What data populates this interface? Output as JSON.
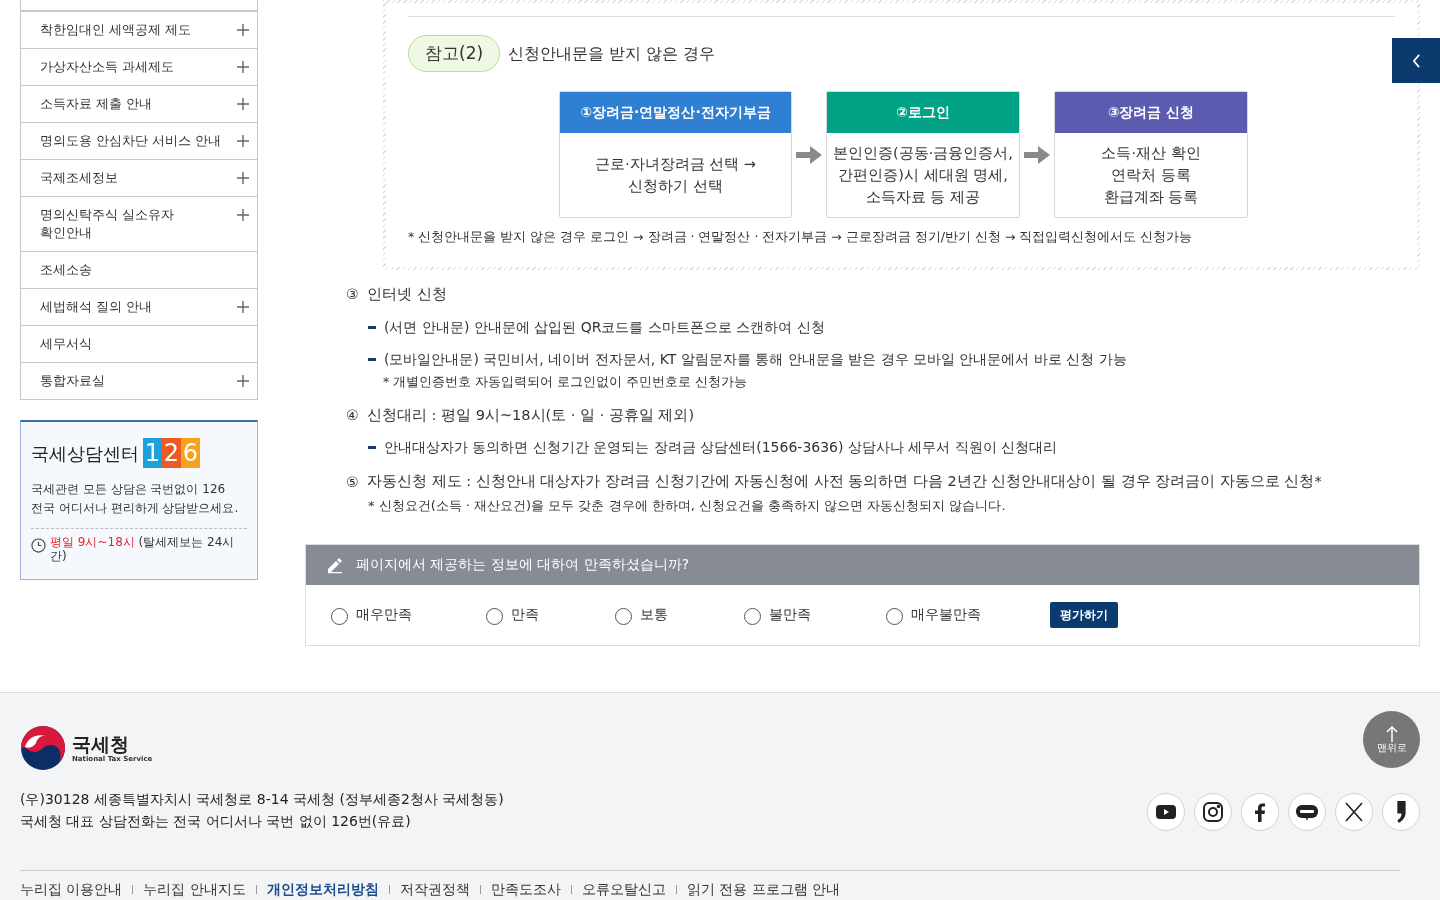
{
  "sidebar": {
    "items": [
      {
        "label": "착한임대인 세액공제 제도",
        "expandable": true
      },
      {
        "label": "가상자산소득 과세제도",
        "expandable": true
      },
      {
        "label": "소득자료 제출 안내",
        "expandable": true
      },
      {
        "label": "명의도용 안심차단 서비스 안내",
        "expandable": true
      },
      {
        "label": "국제조세정보",
        "expandable": true
      },
      {
        "label": "명의신탁주식 실소유자 확인안내",
        "expandable": true
      },
      {
        "label": "조세소송",
        "expandable": false
      },
      {
        "label": "세법해석 질의 안내",
        "expandable": true
      },
      {
        "label": "세무서식",
        "expandable": false
      },
      {
        "label": "통합자료실",
        "expandable": true
      }
    ]
  },
  "counsel": {
    "title": "국세상담센터",
    "digits": [
      "1",
      "2",
      "6"
    ],
    "description": [
      "국세관련 모든 상담은 국번없이 126",
      "전국 어디서나 편리하게 상담받으세요."
    ],
    "hours": "평일 9시~18시",
    "hours_note": "(탈세제보는 24시간)"
  },
  "reference": {
    "badge": "참고(2)",
    "title": "신청안내문을 받지 않은 경우",
    "steps": [
      {
        "title": "①장려금·연말정산·전자기부금",
        "color": "#2f7fd2",
        "lines": [
          "근로·자녀장려금 선택 →",
          "신청하기 선택"
        ]
      },
      {
        "title": "②로그인",
        "color": "#00a386",
        "lines": [
          "본인인증(공동·금융인증서,",
          "간편인증)시 세대원 명세,",
          "소득자료 등 제공"
        ]
      },
      {
        "title": "③장려금 신청",
        "color": "#5b5bb0",
        "lines": [
          "소득·재산 확인",
          "연락처 등록",
          "환급계좌 등록"
        ]
      }
    ],
    "note": "* 신청안내문을 받지 않은 경우 로그인 → 장려금 · 연말정산 · 전자기부금 → 근로장려금 정기/반기 신청 → 직접입력신청에서도 신청가능"
  },
  "sections": [
    {
      "number": "③",
      "title": "인터넷 신청",
      "bullets": [
        {
          "text": "(서면 안내문) 안내문에 삽입된 QR코드를 스마트폰으로 스캔하여 신청"
        },
        {
          "text": "(모바일안내문) 국민비서, 네이버 전자문서, KT 알림문자를 통해 안내문을 받은 경우 모바일 안내문에서 바로 신청 가능",
          "note": "* 개별인증번호 자동입력되어 로그인없이 주민번호로 신청가능"
        }
      ]
    },
    {
      "number": "④",
      "title": "신청대리 : 평일 9시~18시(토 · 일 · 공휴일 제외)",
      "bullets": [
        {
          "text": "안내대상자가 동의하면 신청기간 운영되는 장려금 상담센터(1566-3636) 상담사나 세무서 직원이 신청대리"
        }
      ]
    },
    {
      "number": "⑤",
      "title": "자동신청 제도 : 신청안내 대상자가 장려금 신청기간에 자동신청에 사전 동의하면 다음 2년간 신청안내대상이 될 경우 장려금이 자동으로 신청*",
      "note": "* 신청요건(소득 · 재산요건)을 모두 갖춘 경우에 한하며, 신청요건을 충족하지 않으면 자동신청되지 않습니다."
    }
  ],
  "survey": {
    "question": "페이지에서 제공하는 정보에 대하여 만족하셨습니까?",
    "options": [
      {
        "label": "매우만족",
        "selected": false
      },
      {
        "label": "만족",
        "selected": false
      },
      {
        "label": "보통",
        "selected": false
      },
      {
        "label": "불만족",
        "selected": false
      },
      {
        "label": "매우불만족",
        "selected": false
      }
    ],
    "submit": "평가하기"
  },
  "top_button": "맨위로",
  "footer": {
    "logo": "국세청",
    "logo_sub": "National Tax Service",
    "address": [
      "(우)30128 세종특별자치시 국세청로 8-14 국세청 (정부세종2청사 국세청동)",
      "국세청 대표 상담전화는 전국 어디서나 국번 없이 126번(유료)"
    ],
    "links": [
      {
        "label": "누리집 이용안내",
        "emphasized": false
      },
      {
        "label": "누리집 안내지도",
        "emphasized": false
      },
      {
        "label": "개인정보처리방침",
        "emphasized": true
      },
      {
        "label": "저작권정책",
        "emphasized": false
      },
      {
        "label": "만족도조사",
        "emphasized": false
      },
      {
        "label": "오류오탈신고",
        "emphasized": false
      },
      {
        "label": "읽기 전용 프로그램 안내",
        "emphasized": false
      }
    ]
  }
}
